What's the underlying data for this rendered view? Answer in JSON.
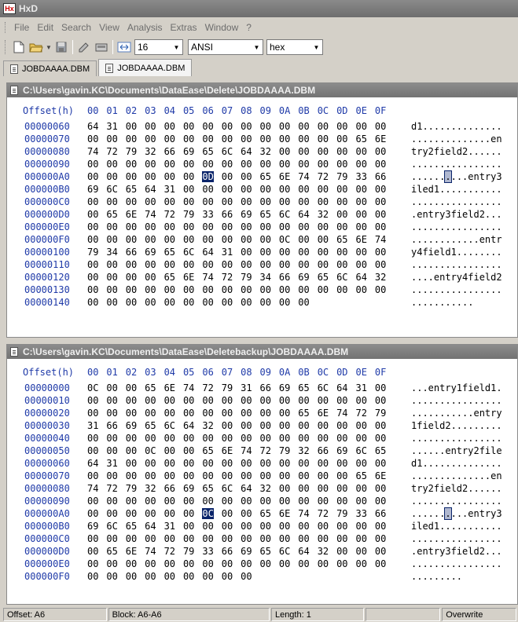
{
  "app": {
    "title": "HxD",
    "icon_glyph_a": "H",
    "icon_glyph_b": "x"
  },
  "menu": [
    "File",
    "Edit",
    "Search",
    "View",
    "Analysis",
    "Extras",
    "Window",
    "?"
  ],
  "toolbar": {
    "bytes_per_row": "16",
    "charset": "ANSI",
    "offset_base": "hex",
    "icons": [
      "new-file-icon",
      "open-folder-icon",
      "save-icon",
      "tools-icon",
      "disk-icon",
      "width-icon"
    ]
  },
  "tabs": [
    {
      "label": "JOBDAAAA.DBM",
      "active": false
    },
    {
      "label": "JOBDAAAA.DBM",
      "active": true
    }
  ],
  "header": {
    "offset_label": "Offset(h)",
    "columns": [
      "00",
      "01",
      "02",
      "03",
      "04",
      "05",
      "06",
      "07",
      "08",
      "09",
      "0A",
      "0B",
      "0C",
      "0D",
      "0E",
      "0F"
    ]
  },
  "panes": [
    {
      "path": "C:\\Users\\gavin.KC\\Documents\\DataEase\\Delete\\JOBDAAAA.DBM",
      "rows": [
        {
          "offset": "00000060",
          "bytes": "64 31 00 00 00 00 00 00 00 00 00 00 00 00 00 00",
          "text": "d1.............."
        },
        {
          "offset": "00000070",
          "bytes": "00 00 00 00 00 00 00 00 00 00 00 00 00 00 65 6E",
          "text": "..............en"
        },
        {
          "offset": "00000080",
          "bytes": "74 72 79 32 66 69 65 6C 64 32 00 00 00 00 00 00",
          "text": "try2field2......"
        },
        {
          "offset": "00000090",
          "bytes": "00 00 00 00 00 00 00 00 00 00 00 00 00 00 00 00",
          "text": "................"
        },
        {
          "offset": "000000A0",
          "bytes": "00 00 00 00 00 00 0D 00 00 65 6E 74 72 79 33 66",
          "text": "..........entry3f",
          "sel_byte": 6,
          "sel_text": 6
        },
        {
          "offset": "000000B0",
          "bytes": "69 6C 65 64 31 00 00 00 00 00 00 00 00 00 00 00",
          "text": "iled1..........."
        },
        {
          "offset": "000000C0",
          "bytes": "00 00 00 00 00 00 00 00 00 00 00 00 00 00 00 00",
          "text": "................"
        },
        {
          "offset": "000000D0",
          "bytes": "00 65 6E 74 72 79 33 66 69 65 6C 64 32 00 00 00",
          "text": ".entry3field2..."
        },
        {
          "offset": "000000E0",
          "bytes": "00 00 00 00 00 00 00 00 00 00 00 00 00 00 00 00",
          "text": "................"
        },
        {
          "offset": "000000F0",
          "bytes": "00 00 00 00 00 00 00 00 00 00 0C 00 00 65 6E 74 72",
          "text": "............entr"
        },
        {
          "offset": "00000100",
          "bytes": "79 34 66 69 65 6C 64 31 00 00 00 00 00 00 00 00",
          "text": "y4field1........"
        },
        {
          "offset": "00000110",
          "bytes": "00 00 00 00 00 00 00 00 00 00 00 00 00 00 00 00",
          "text": "................"
        },
        {
          "offset": "00000120",
          "bytes": "00 00 00 00 65 6E 74 72 79 34 66 69 65 6C 64 32",
          "text": "....entry4field2"
        },
        {
          "offset": "00000130",
          "bytes": "00 00 00 00 00 00 00 00 00 00 00 00 00 00 00 00",
          "text": "................"
        },
        {
          "offset": "00000140",
          "bytes": "00 00 00 00 00 00 00 00 00 00 00 00",
          "text": "..........."
        }
      ]
    },
    {
      "path": "C:\\Users\\gavin.KC\\Documents\\DataEase\\Deletebackup\\JOBDAAAA.DBM",
      "rows": [
        {
          "offset": "00000000",
          "bytes": "0C 00 00 65 6E 74 72 79 31 66 69 65 6C 64 31 00",
          "text": "...entry1field1."
        },
        {
          "offset": "00000010",
          "bytes": "00 00 00 00 00 00 00 00 00 00 00 00 00 00 00 00",
          "text": "................"
        },
        {
          "offset": "00000020",
          "bytes": "00 00 00 00 00 00 00 00 00 00 00 65 6E 74 72 79",
          "text": "...........entry"
        },
        {
          "offset": "00000030",
          "bytes": "31 66 69 65 6C 64 32 00 00 00 00 00 00 00 00 00",
          "text": "1field2........."
        },
        {
          "offset": "00000040",
          "bytes": "00 00 00 00 00 00 00 00 00 00 00 00 00 00 00 00",
          "text": "................"
        },
        {
          "offset": "00000050",
          "bytes": "00 00 00 0C 00 00 65 6E 74 72 79 32 66 69 6C 65",
          "text": "......entry2file"
        },
        {
          "offset": "00000060",
          "bytes": "64 31 00 00 00 00 00 00 00 00 00 00 00 00 00 00",
          "text": "d1.............."
        },
        {
          "offset": "00000070",
          "bytes": "00 00 00 00 00 00 00 00 00 00 00 00 00 00 65 6E",
          "text": "..............en"
        },
        {
          "offset": "00000080",
          "bytes": "74 72 79 32 66 69 65 6C 64 32 00 00 00 00 00 00",
          "text": "try2field2......"
        },
        {
          "offset": "00000090",
          "bytes": "00 00 00 00 00 00 00 00 00 00 00 00 00 00 00 00",
          "text": "................"
        },
        {
          "offset": "000000A0",
          "bytes": "00 00 00 00 00 00 0C 00 00 65 6E 74 72 79 33 66",
          "text": "..........entry3f",
          "sel_byte": 6,
          "sel_text": 6
        },
        {
          "offset": "000000B0",
          "bytes": "69 6C 65 64 31 00 00 00 00 00 00 00 00 00 00 00",
          "text": "iled1..........."
        },
        {
          "offset": "000000C0",
          "bytes": "00 00 00 00 00 00 00 00 00 00 00 00 00 00 00 00",
          "text": "................"
        },
        {
          "offset": "000000D0",
          "bytes": "00 65 6E 74 72 79 33 66 69 65 6C 64 32 00 00 00",
          "text": ".entry3field2..."
        },
        {
          "offset": "000000E0",
          "bytes": "00 00 00 00 00 00 00 00 00 00 00 00 00 00 00 00",
          "text": "................"
        },
        {
          "offset": "000000F0",
          "bytes": "00 00 00 00 00 00 00 00 00",
          "text": "........."
        }
      ]
    }
  ],
  "status": {
    "offset": "Offset: A6",
    "block": "Block: A6-A6",
    "length": "Length: 1",
    "empty": "",
    "mode": "Overwrite"
  },
  "colors": {
    "offset_blue": "#1f3aa8",
    "selection": "#0a246a"
  }
}
